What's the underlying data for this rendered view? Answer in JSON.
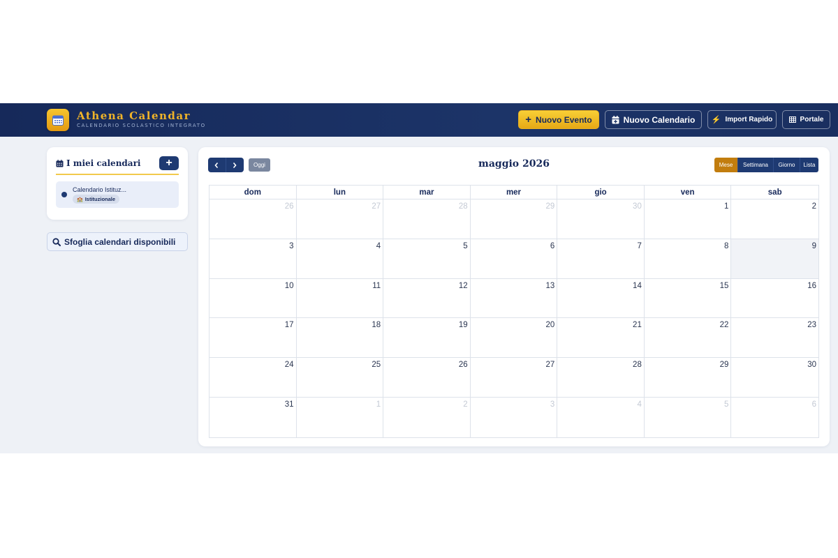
{
  "header": {
    "brand_title": "Athena Calendar",
    "brand_subtitle": "CALENDARIO SCOLASTICO INTEGRATO",
    "logo_icon": "calendar-icon",
    "buttons": {
      "new_event": "Nuovo Evento",
      "new_calendar": "Nuovo Calendario",
      "quick_import": "Import Rapido",
      "portal": "Portale"
    }
  },
  "sidebar": {
    "my_calendars_title": "I miei calendari",
    "add_label": "+",
    "calendars": [
      {
        "name": "Calendario Istituz...",
        "tag": "Istituzionale",
        "color": "#1e3a72"
      }
    ],
    "browse_label": "Sfoglia calendari disponibili"
  },
  "calendar": {
    "title": "maggio 2026",
    "today_label": "Oggi",
    "views": [
      "Mese",
      "Settimana",
      "Giorno",
      "Lista"
    ],
    "active_view": "Mese",
    "weekdays": [
      "dom",
      "lun",
      "mar",
      "mer",
      "gio",
      "ven",
      "sab"
    ],
    "weeks": [
      [
        "26",
        "27",
        "28",
        "29",
        "30",
        "1",
        "2"
      ],
      [
        "3",
        "4",
        "5",
        "6",
        "7",
        "8",
        "9"
      ],
      [
        "10",
        "11",
        "12",
        "13",
        "14",
        "15",
        "16"
      ],
      [
        "17",
        "18",
        "19",
        "20",
        "21",
        "22",
        "23"
      ],
      [
        "24",
        "25",
        "26",
        "27",
        "28",
        "29",
        "30"
      ],
      [
        "31",
        "1",
        "2",
        "3",
        "4",
        "5",
        "6"
      ]
    ],
    "today": "9"
  },
  "colors": {
    "navy": "#1e3a72",
    "gold": "#f0b429",
    "active_view": "#c27d0e"
  }
}
